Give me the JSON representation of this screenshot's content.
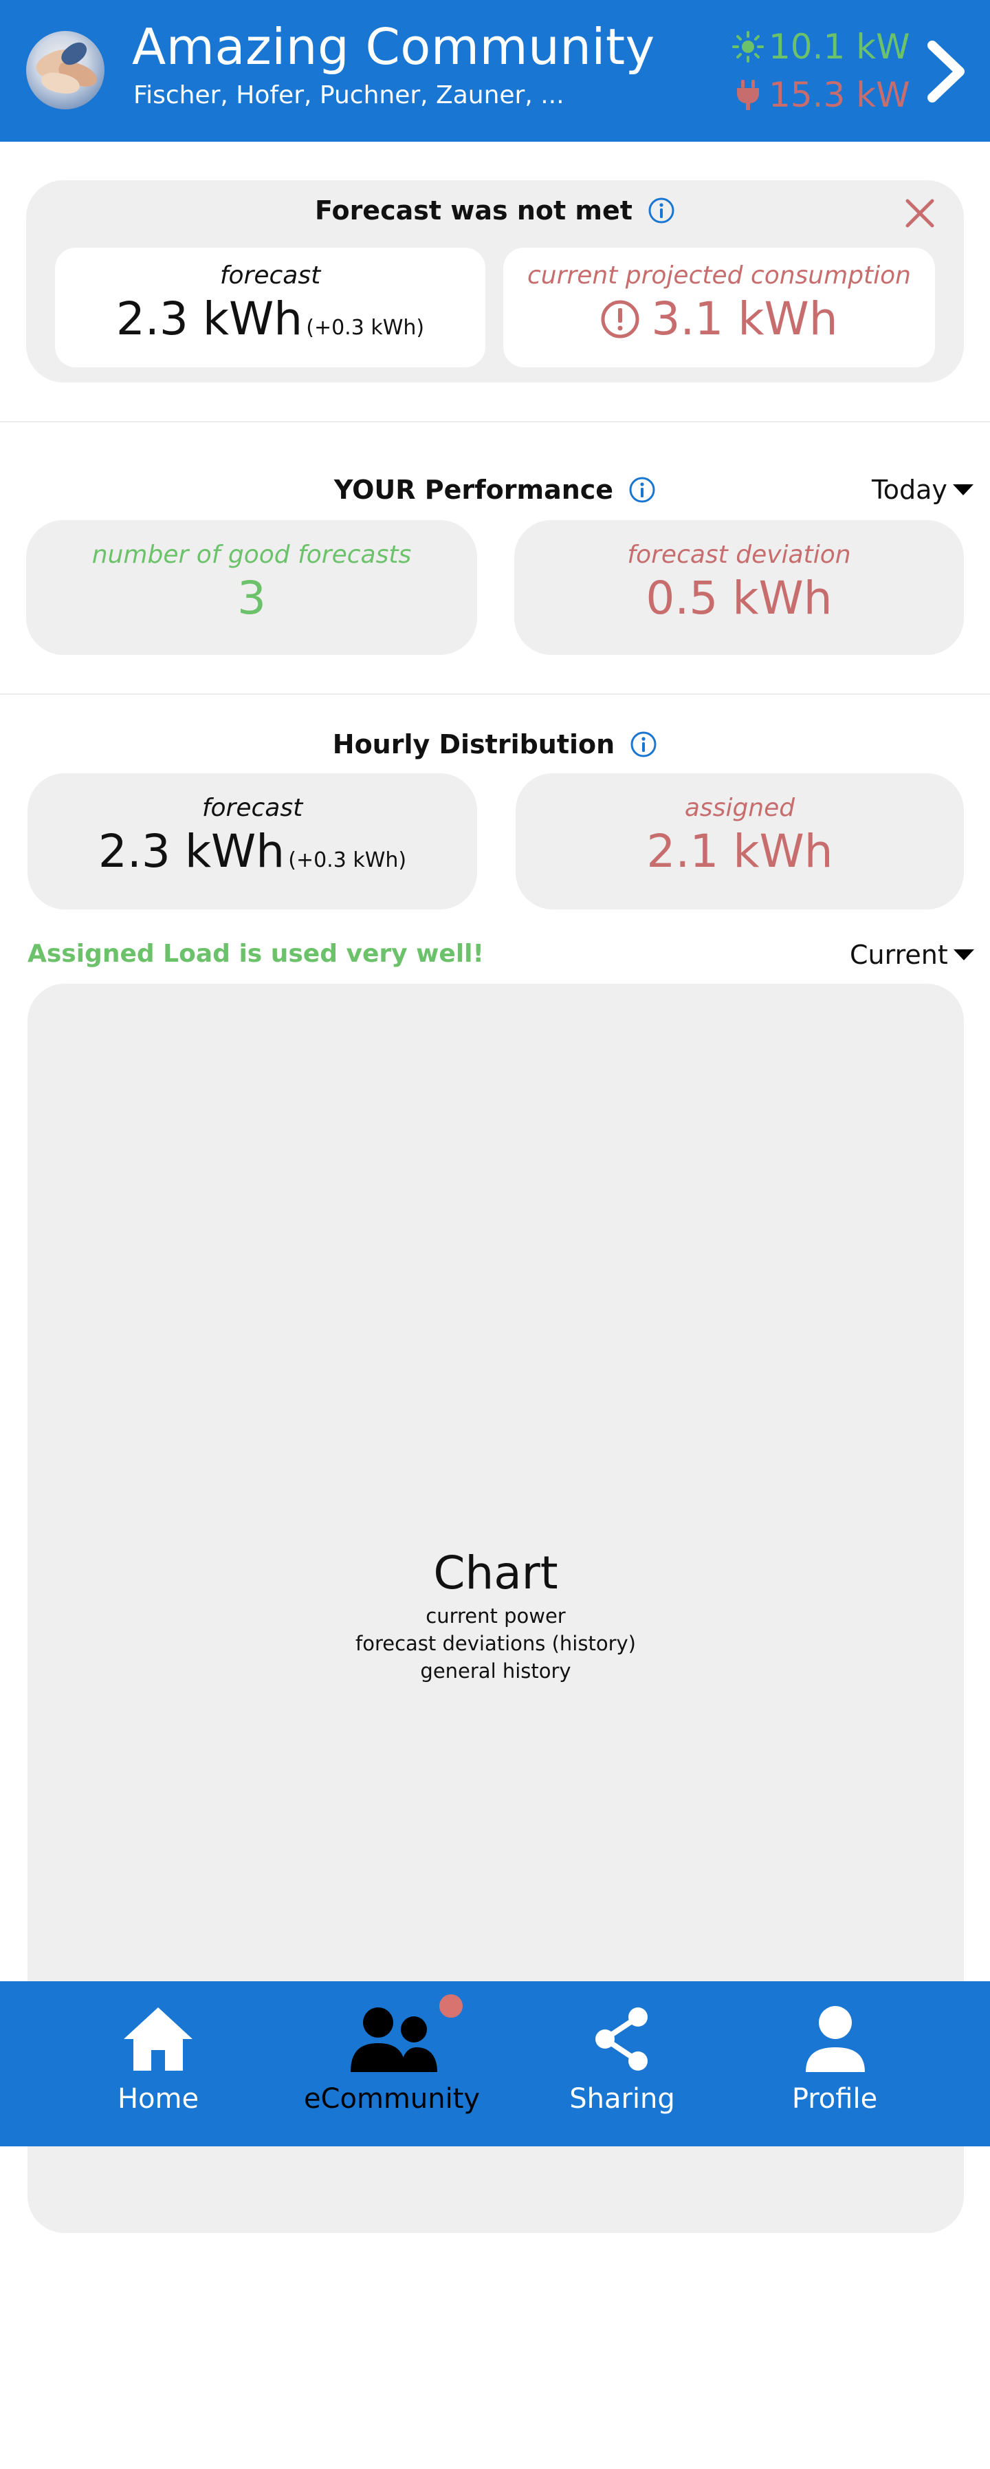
{
  "header": {
    "title": "Amazing Community",
    "members": "Fischer, Hofer, Puchner, Zauner, ...",
    "production": "10.1 kW",
    "consumption": "15.3 kW",
    "production_icon": "sun-icon",
    "consumption_icon": "plug-icon",
    "production_color": "#6cc26a",
    "consumption_color": "#c76d6d"
  },
  "alert": {
    "title": "Forecast was not met",
    "forecast_label": "forecast",
    "forecast_value": "2.3 kWh",
    "forecast_delta": "(+0.3 kWh)",
    "projected_label": "current projected consumption",
    "projected_value": "3.1 kWh"
  },
  "performance": {
    "title": "YOUR Performance",
    "period": "Today",
    "good_label": "number of good forecasts",
    "good_value": "3",
    "deviation_label": "forecast deviation",
    "deviation_value": "0.5 kWh"
  },
  "hourly": {
    "title": "Hourly Distribution",
    "forecast_label": "forecast",
    "forecast_value": "2.3 kWh",
    "forecast_delta": "(+0.3 kWh)",
    "assigned_label": "assigned",
    "assigned_value": "2.1 kWh",
    "status": "Assigned Load is used very well!",
    "mode": "Current"
  },
  "chart": {
    "title": "Chart",
    "lines": [
      "current power",
      "forecast deviations (history)",
      "general history"
    ]
  },
  "nav": {
    "items": [
      {
        "label": "Home",
        "icon": "home-icon"
      },
      {
        "label": "eCommunity",
        "icon": "community-icon"
      },
      {
        "label": "Sharing",
        "icon": "share-icon"
      },
      {
        "label": "Profile",
        "icon": "profile-icon"
      }
    ],
    "active": "eCommunity",
    "accent": "#1976d2",
    "badge_color": "#d9736f"
  }
}
